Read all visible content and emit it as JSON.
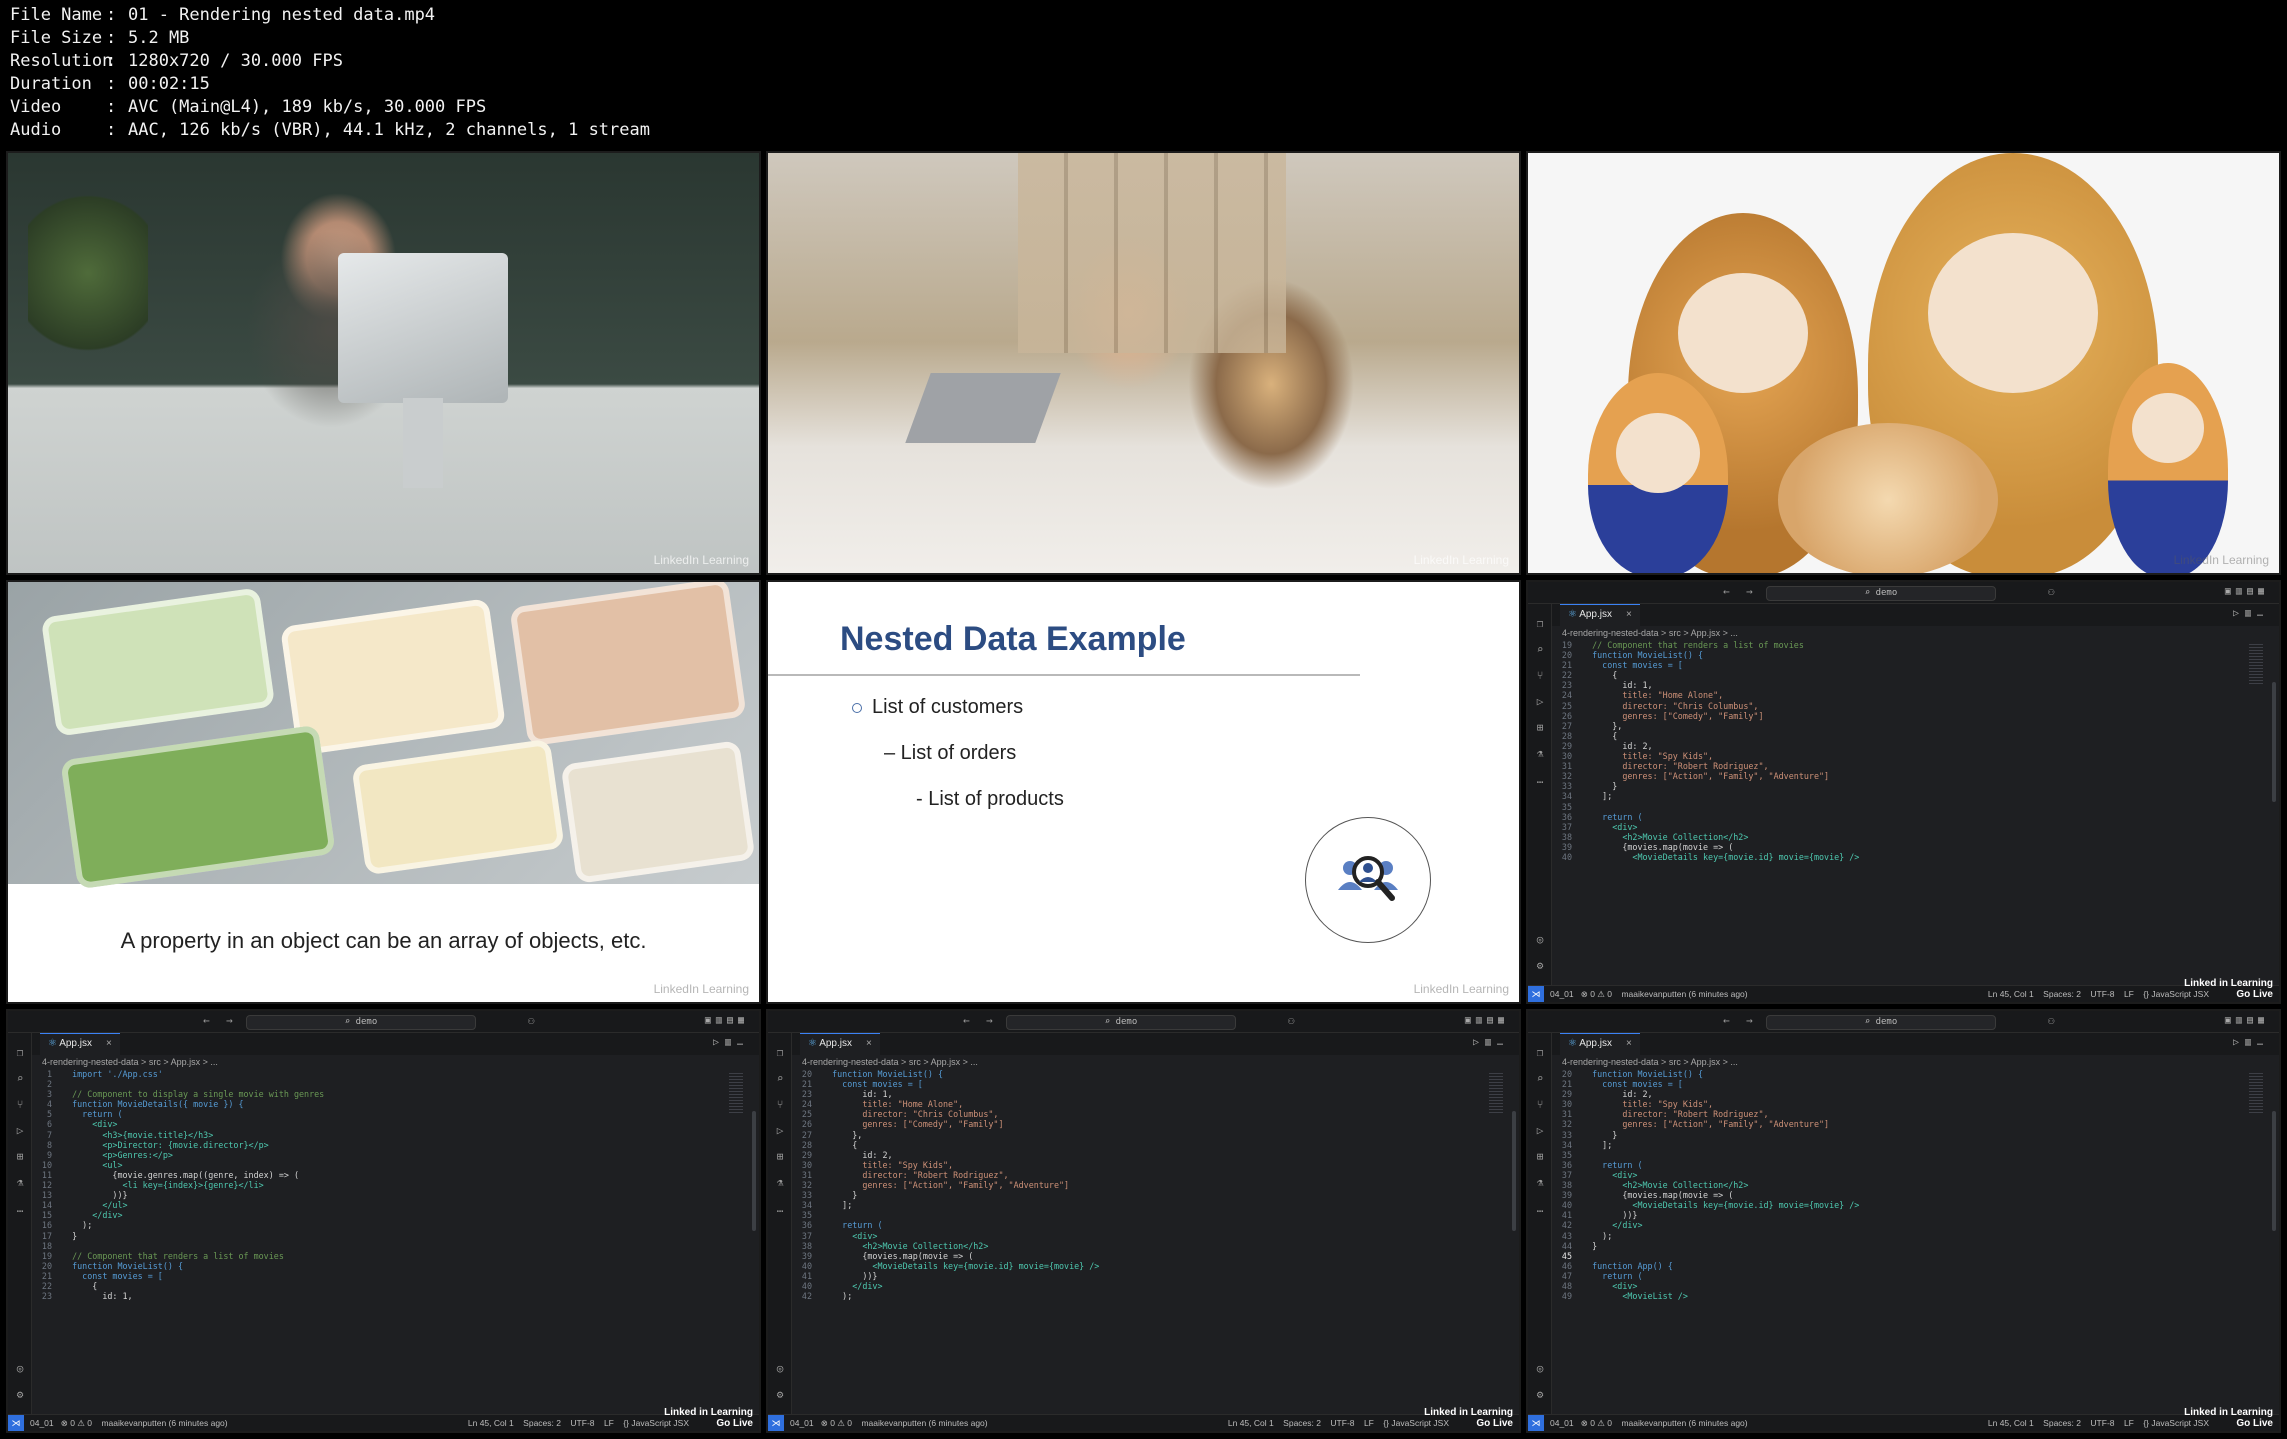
{
  "info": {
    "rows": [
      {
        "key": "File Name",
        "value": "01 - Rendering nested data.mp4"
      },
      {
        "key": "File Size",
        "value": "5.2 MB"
      },
      {
        "key": "Resolution",
        "value": "1280x720 / 30.000 FPS"
      },
      {
        "key": "Duration",
        "value": "00:02:15"
      },
      {
        "key": "Video",
        "value": "AVC (Main@L4), 189 kb/s, 30.000 FPS"
      },
      {
        "key": "Audio",
        "value": "AAC, 126 kb/s (VBR), 44.1 kHz, 2 channels, 1 stream"
      }
    ],
    "separator": ":"
  },
  "watermark": "LinkedIn Learning",
  "slide_food": {
    "caption": "A property in an object can be an array of objects, etc."
  },
  "slide_nested": {
    "title": "Nested Data Example",
    "items": [
      "List of customers",
      "–  List of orders",
      "- List of products"
    ],
    "badge_icon": "search-people-icon"
  },
  "editor": {
    "search": "demo",
    "tab": "App.jsx",
    "close": "×",
    "breadcrumb": "4-rendering-nested-data  >  src  >  App.jsx  > ...",
    "status_left": "04_01   ⊗ 0 ⚠ 0    maaikevanputten (6 minutes ago)",
    "status_right": "Ln 45, Col 1    Spaces: 2    UTF-8    LF    {} JavaScript JSX",
    "brand_1": "Linked in Learning",
    "brand_2": "Go Live",
    "panels": [
      {
        "lines": [
          {
            "n": "19",
            "t": "  // Component that renders a list of movies"
          },
          {
            "n": "20",
            "t": "  function MovieList() {"
          },
          {
            "n": "21",
            "t": "    const movies = ["
          },
          {
            "n": "22",
            "t": "      {"
          },
          {
            "n": "23",
            "t": "        id: 1,"
          },
          {
            "n": "24",
            "t": "        title: \"Home Alone\","
          },
          {
            "n": "25",
            "t": "        director: \"Chris Columbus\","
          },
          {
            "n": "26",
            "t": "        genres: [\"Comedy\", \"Family\"]"
          },
          {
            "n": "27",
            "t": "      },"
          },
          {
            "n": "28",
            "t": "      {"
          },
          {
            "n": "29",
            "t": "        id: 2,"
          },
          {
            "n": "30",
            "t": "        title: \"Spy Kids\","
          },
          {
            "n": "31",
            "t": "        director: \"Robert Rodriguez\","
          },
          {
            "n": "32",
            "t": "        genres: [\"Action\", \"Family\", \"Adventure\"]"
          },
          {
            "n": "33",
            "t": "      }"
          },
          {
            "n": "34",
            "t": "    ];"
          },
          {
            "n": "35",
            "t": ""
          },
          {
            "n": "36",
            "t": "    return ("
          },
          {
            "n": "37",
            "t": "      <div>"
          },
          {
            "n": "38",
            "t": "        <h2>Movie Collection</h2>"
          },
          {
            "n": "39",
            "t": "        {movies.map(movie => ("
          },
          {
            "n": "40",
            "t": "          <MovieDetails key={movie.id} movie={movie} />"
          }
        ]
      },
      {
        "lines": [
          {
            "n": "1",
            "t": "  import './App.css'"
          },
          {
            "n": "2",
            "t": ""
          },
          {
            "n": "3",
            "t": "  // Component to display a single movie with genres"
          },
          {
            "n": "4",
            "t": "  function MovieDetails({ movie }) {"
          },
          {
            "n": "5",
            "t": "    return ("
          },
          {
            "n": "6",
            "t": "      <div>"
          },
          {
            "n": "7",
            "t": "        <h3>{movie.title}</h3>"
          },
          {
            "n": "8",
            "t": "        <p>Director: {movie.director}</p>"
          },
          {
            "n": "9",
            "t": "        <p>Genres:</p>"
          },
          {
            "n": "10",
            "t": "        <ul>"
          },
          {
            "n": "11",
            "t": "          {movie.genres.map((genre, index) => ("
          },
          {
            "n": "12",
            "t": "            <li key={index}>{genre}</li>"
          },
          {
            "n": "13",
            "t": "          ))}"
          },
          {
            "n": "14",
            "t": "        </ul>"
          },
          {
            "n": "15",
            "t": "      </div>"
          },
          {
            "n": "16",
            "t": "    );"
          },
          {
            "n": "17",
            "t": "  }"
          },
          {
            "n": "18",
            "t": ""
          },
          {
            "n": "19",
            "t": "  // Component that renders a list of movies"
          },
          {
            "n": "20",
            "t": "  function MovieList() {"
          },
          {
            "n": "21",
            "t": "    const movies = ["
          },
          {
            "n": "22",
            "t": "      {"
          },
          {
            "n": "23",
            "t": "        id: 1,"
          }
        ]
      },
      {
        "lines": [
          {
            "n": "20",
            "t": "  function MovieList() {"
          },
          {
            "n": "21",
            "t": "    const movies = ["
          },
          {
            "n": "23",
            "t": "        id: 1,"
          },
          {
            "n": "24",
            "t": "        title: \"Home Alone\","
          },
          {
            "n": "25",
            "t": "        director: \"Chris Columbus\","
          },
          {
            "n": "26",
            "t": "        genres: [\"Comedy\", \"Family\"]"
          },
          {
            "n": "27",
            "t": "      },"
          },
          {
            "n": "28",
            "t": "      {"
          },
          {
            "n": "29",
            "t": "        id: 2,"
          },
          {
            "n": "30",
            "t": "        title: \"Spy Kids\","
          },
          {
            "n": "31",
            "t": "        director: \"Robert Rodriguez\","
          },
          {
            "n": "32",
            "t": "        genres: [\"Action\", \"Family\", \"Adventure\"]"
          },
          {
            "n": "33",
            "t": "      }"
          },
          {
            "n": "34",
            "t": "    ];"
          },
          {
            "n": "35",
            "t": ""
          },
          {
            "n": "36",
            "t": "    return ("
          },
          {
            "n": "37",
            "t": "      <div>"
          },
          {
            "n": "38",
            "t": "        <h2>Movie Collection</h2>"
          },
          {
            "n": "39",
            "t": "        {movies.map(movie => ("
          },
          {
            "n": "40",
            "t": "          <MovieDetails key={movie.id} movie={movie} />"
          },
          {
            "n": "41",
            "t": "        ))}"
          },
          {
            "n": "40",
            "t": "      </div>"
          },
          {
            "n": "42",
            "t": "    );"
          }
        ]
      },
      {
        "lines": [
          {
            "n": "20",
            "t": "  function MovieList() {"
          },
          {
            "n": "21",
            "t": "    const movies = ["
          },
          {
            "n": "29",
            "t": "        id: 2,"
          },
          {
            "n": "30",
            "t": "        title: \"Spy Kids\","
          },
          {
            "n": "31",
            "t": "        director: \"Robert Rodriguez\","
          },
          {
            "n": "32",
            "t": "        genres: [\"Action\", \"Family\", \"Adventure\"]"
          },
          {
            "n": "33",
            "t": "      }"
          },
          {
            "n": "34",
            "t": "    ];"
          },
          {
            "n": "35",
            "t": ""
          },
          {
            "n": "36",
            "t": "    return ("
          },
          {
            "n": "37",
            "t": "      <div>"
          },
          {
            "n": "38",
            "t": "        <h2>Movie Collection</h2>"
          },
          {
            "n": "39",
            "t": "        {movies.map(movie => ("
          },
          {
            "n": "40",
            "t": "          <MovieDetails key={movie.id} movie={movie} />"
          },
          {
            "n": "41",
            "t": "        ))}"
          },
          {
            "n": "42",
            "t": "      </div>"
          },
          {
            "n": "43",
            "t": "    );"
          },
          {
            "n": "44",
            "t": "  }"
          },
          {
            "n": "45",
            "t": "",
            "cur": true
          },
          {
            "n": "46",
            "t": "  function App() {"
          },
          {
            "n": "47",
            "t": "    return ("
          },
          {
            "n": "48",
            "t": "      <div>"
          },
          {
            "n": "49",
            "t": "        <MovieList />"
          }
        ]
      }
    ]
  }
}
